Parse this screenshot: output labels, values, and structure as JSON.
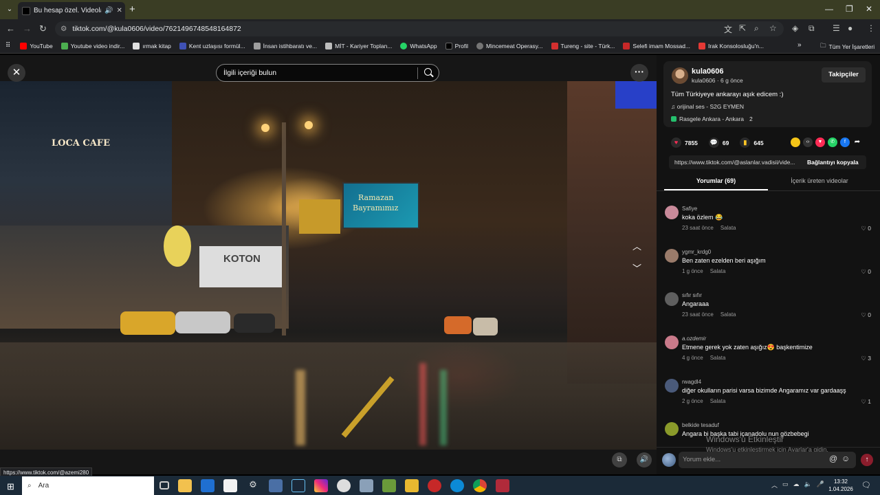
{
  "browser": {
    "tab_title": "Bu hesap özel. Videoların",
    "url": "tiktok.com/@kula0606/video/7621496748548164872",
    "bookmarks": [
      {
        "label": "YouTube",
        "color": "#ff0000"
      },
      {
        "label": "Youtube video indir...",
        "color": "#4caf50"
      },
      {
        "label": "ırmak kitap",
        "color": "#e0e0e0"
      },
      {
        "label": "Kent uzlaşısı formül...",
        "color": "#3f51b5"
      },
      {
        "label": "İnsan istihbaratı ve...",
        "color": "#9e9e9e"
      },
      {
        "label": "MİT - Kariyer Toplan...",
        "color": "#bdbdbd"
      },
      {
        "label": "WhatsApp",
        "color": "#25d366"
      },
      {
        "label": "Profil",
        "color": "#000000"
      },
      {
        "label": "Mincemeat Operasy...",
        "color": "#757575"
      },
      {
        "label": "Tureng - site - Türk...",
        "color": "#d32f2f"
      },
      {
        "label": "Selefi imam Mossad...",
        "color": "#c62828"
      },
      {
        "label": "Irak Konsolosluğu'n...",
        "color": "#e53935"
      }
    ],
    "all_bookmarks": "Tüm Yer İşaretleri",
    "status_url": "https://www.tiktok.com/@azemi280"
  },
  "video": {
    "search_placeholder": "İlgili içeriği bulun",
    "billboard_line1": "Ramazan",
    "billboard_line2": "Bayramımız",
    "sign_loca": "LOCA CAFE",
    "sign_koton": "KOTON"
  },
  "post": {
    "username": "kula0606",
    "subline": "kula0606 · 6 g önce",
    "follow_label": "Takipçiler",
    "description": "Tüm Türkiyeye ankarayı aşık edicem :)",
    "sound": "♫  orijinal ses - S2G EYMEN",
    "location": "Rasgele Ankara - Ankara",
    "location_extra": "2",
    "likes": "7855",
    "comments": "69",
    "saves": "645",
    "link_url": "https://www.tiktok.com/@aslanlar.vadisii/vide...",
    "copy_link": "Bağlantıyı kopyala"
  },
  "tabs": {
    "comments": "Yorumlar (69)",
    "creators": "İçerik üreten videolar"
  },
  "comments": [
    {
      "user": "Safiye",
      "text": "koka özlem 😂",
      "time": "23 saat önce",
      "reply": "Salata",
      "likes": "0",
      "avatar": "#c98a9a"
    },
    {
      "user": "ygmr_krdg0",
      "text": "Ben zaten ezelden beri aşığım",
      "time": "1 g önce",
      "reply": "Salata",
      "likes": "0",
      "avatar": "#9a7b6a"
    },
    {
      "user": "sıfır sıfır",
      "text": "Angaraaa",
      "time": "23 saat önce",
      "reply": "Salata",
      "likes": "0",
      "avatar": "#5f5f5f"
    },
    {
      "user": "a.ozdemir",
      "text": "Etmene gerek yok zaten aşığız😍 başkentimize",
      "time": "4 g önce",
      "reply": "Salata",
      "likes": "3",
      "avatar": "#c97a8a"
    },
    {
      "user": "rwagdl4",
      "text": "diğer okulların parisi varsa bizimde Angaramız var gardaaşş",
      "time": "2 g önce",
      "reply": "Salata",
      "likes": "1",
      "avatar": "#4a5a7a"
    },
    {
      "user": "belkide tesaduf",
      "text": "Angara bi başka tabi içanadolu nun gözbebegi",
      "time": "",
      "reply": "",
      "likes": "",
      "avatar": "#8a9a2a"
    }
  ],
  "composer": {
    "placeholder": "Yorum ekle...",
    "watermark_title": "Windows'u Etkinleştir",
    "watermark_text": "Windows'u etkinleştirmek için Ayarlar'a gidin."
  },
  "taskbar": {
    "search_label": "Ara",
    "time": "13:32",
    "date": "1.04.2026"
  }
}
